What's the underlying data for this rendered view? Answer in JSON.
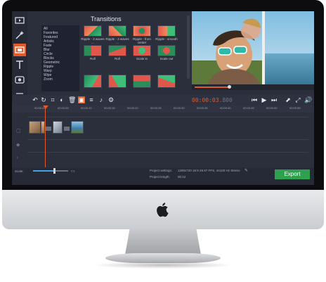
{
  "transitions_panel": {
    "title": "Transitions",
    "categories": [
      "All",
      "Favorites",
      "Featured",
      "Artistic",
      "Fade",
      "Blur",
      "Circle",
      "Blocks",
      "Geometric",
      "Ripple",
      "Warp",
      "Wipe",
      "Zoom"
    ],
    "tiles": [
      {
        "label": "Ripple - 3 waves ..."
      },
      {
        "label": "Ripple - 3 waves ..."
      },
      {
        "label": "Ripple - from center"
      },
      {
        "label": "Ripple - smooth"
      },
      {
        "label": "Roll"
      },
      {
        "label": "Roll"
      },
      {
        "label": "Scale in"
      },
      {
        "label": "Scale out"
      },
      {
        "label": ""
      },
      {
        "label": ""
      },
      {
        "label": ""
      },
      {
        "label": ""
      }
    ]
  },
  "player": {
    "timecode_current": "00:00:03",
    "timecode_frames": ".800"
  },
  "ruler": {
    "ticks": [
      "00:00:00",
      "00:00:05",
      "00:00:10",
      "00:00:15",
      "00:00:20",
      "00:00:25",
      "00:00:30",
      "00:00:35",
      "00:00:40",
      "00:00:45",
      "00:00:50",
      "00:00:55"
    ]
  },
  "bottom": {
    "scale_label": "Scale:",
    "project_settings_label": "Project settings:",
    "project_settings_value": "1280x720 16:9 29.97 FPS, 44100 Hz Stereo",
    "project_length_label": "Project length:",
    "project_length_value": "00:12",
    "export_label": "Export"
  },
  "colors": {
    "accent_orange": "#e35a2a",
    "export_green": "#2fa04e",
    "panel_bg": "#2b2e3b"
  },
  "icons": {
    "tools": [
      "video-icon",
      "magic-wand-icon",
      "transition-icon",
      "text-icon",
      "record-icon",
      "list-icon"
    ],
    "toolbar": [
      "undo-icon",
      "redo-icon",
      "crop-icon",
      "color-adjust-icon",
      "delete-icon",
      "image-icon",
      "audio-icon",
      "mic-icon",
      "settings-icon"
    ],
    "transport": [
      "skip-back-icon",
      "play-icon",
      "skip-forward-icon",
      "popout-icon",
      "fullscreen-icon",
      "volume-icon"
    ]
  }
}
